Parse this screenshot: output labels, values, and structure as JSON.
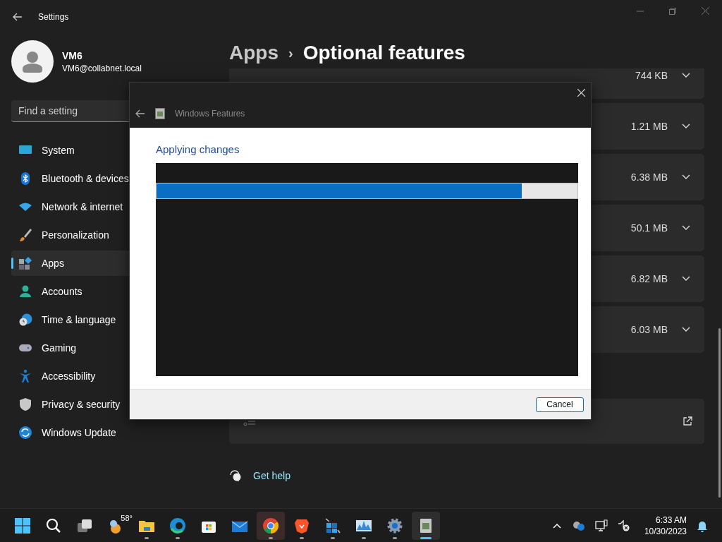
{
  "window": {
    "title": "Settings"
  },
  "profile": {
    "name": "VM6",
    "email": "VM6@collabnet.local"
  },
  "search": {
    "placeholder": "Find a setting"
  },
  "sidebar": {
    "items": [
      {
        "label": "System",
        "kind": "system",
        "selected": false
      },
      {
        "label": "Bluetooth & devices",
        "kind": "bluetooth",
        "selected": false
      },
      {
        "label": "Network & internet",
        "kind": "network",
        "selected": false
      },
      {
        "label": "Personalization",
        "kind": "brush",
        "selected": false
      },
      {
        "label": "Apps",
        "kind": "apps",
        "selected": true
      },
      {
        "label": "Accounts",
        "kind": "person",
        "selected": false
      },
      {
        "label": "Time & language",
        "kind": "clock",
        "selected": false
      },
      {
        "label": "Gaming",
        "kind": "gamepad",
        "selected": false
      },
      {
        "label": "Accessibility",
        "kind": "accessibility",
        "selected": false
      },
      {
        "label": "Privacy & security",
        "kind": "shield",
        "selected": false
      },
      {
        "label": "Windows Update",
        "kind": "update",
        "selected": false
      }
    ]
  },
  "breadcrumb": {
    "parent": "Apps",
    "separator": "›",
    "current": "Optional features"
  },
  "features": [
    {
      "size": "744 KB"
    },
    {
      "size": "1.21 MB"
    },
    {
      "size": "6.38 MB"
    },
    {
      "size": "50.1 MB"
    },
    {
      "size": "6.82 MB"
    },
    {
      "size": "6.03 MB"
    }
  ],
  "more_features": {
    "kind": "link_card"
  },
  "help": {
    "label": "Get help"
  },
  "dialog": {
    "title": "Windows Features",
    "heading": "Applying changes",
    "progress": {
      "level": 0.868
    },
    "buttons": [
      "Cancel"
    ]
  },
  "taskbar": {
    "items": [
      {
        "kind": "start",
        "running": false,
        "selected": false,
        "hovered": false
      },
      {
        "kind": "search",
        "running": false,
        "selected": false,
        "hovered": false
      },
      {
        "kind": "taskview",
        "running": false,
        "selected": false,
        "hovered": false
      },
      {
        "kind": "weather",
        "label": "58°",
        "running": false,
        "selected": false,
        "hovered": false
      },
      {
        "kind": "folder",
        "running": true,
        "selected": false,
        "hovered": false
      },
      {
        "kind": "edge",
        "running": true,
        "selected": false,
        "hovered": false
      },
      {
        "kind": "store",
        "running": false,
        "selected": false,
        "hovered": false
      },
      {
        "kind": "mail",
        "running": false,
        "selected": false,
        "hovered": false
      },
      {
        "kind": "chrome",
        "running": true,
        "selected": false,
        "hovered": true
      },
      {
        "kind": "brave",
        "running": true,
        "selected": false,
        "hovered": false
      },
      {
        "kind": "tiles",
        "running": true,
        "selected": false,
        "hovered": false
      },
      {
        "kind": "monitor",
        "running": true,
        "selected": false,
        "hovered": false
      },
      {
        "kind": "gear",
        "running": true,
        "selected": false,
        "hovered": false
      },
      {
        "kind": "features",
        "running": true,
        "selected": true,
        "hovered": false
      }
    ],
    "time": "6:33 AM",
    "date": "10/30/2023"
  }
}
